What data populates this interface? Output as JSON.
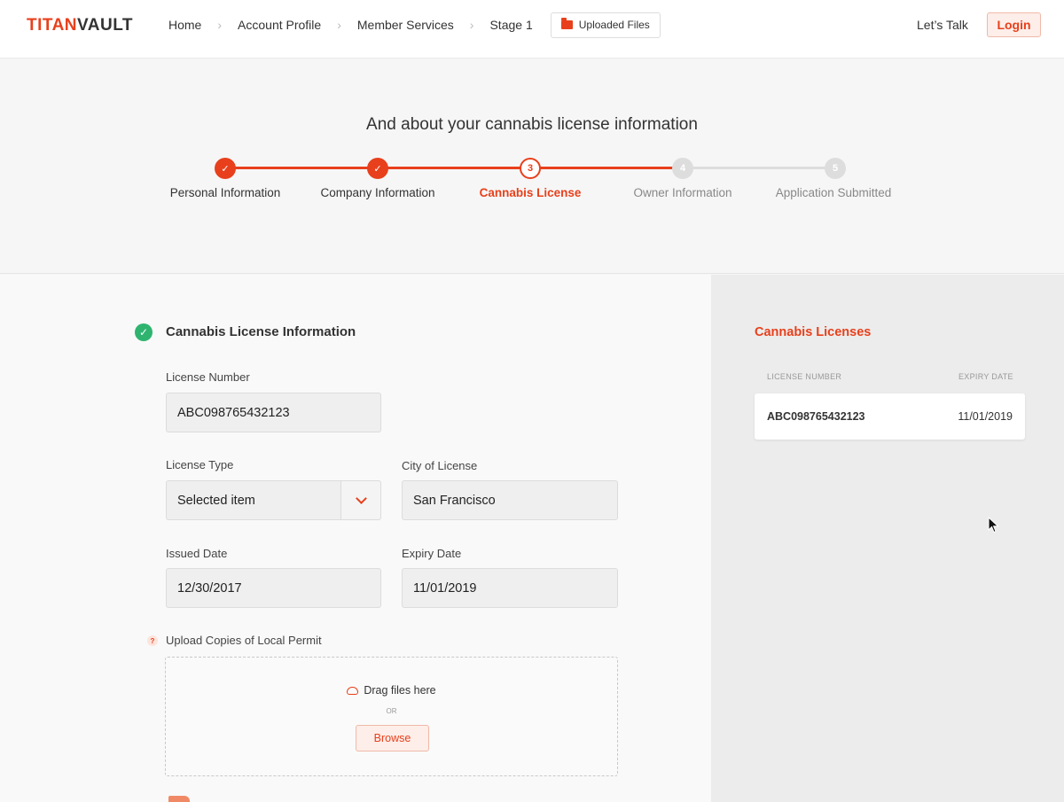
{
  "header": {
    "logo_prefix": "TITAN",
    "logo_suffix": "VAULT",
    "nav": [
      "Home",
      "Account Profile",
      "Member Services",
      "Stage 1"
    ],
    "uploaded_files": "Uploaded Files",
    "lets_talk": "Let’s Talk",
    "login": "Login",
    "accent_color": "#e8401c"
  },
  "hero": {
    "title": "And about your cannabis license information",
    "steps": [
      {
        "num": "1",
        "label": "Personal Information",
        "status": "done"
      },
      {
        "num": "2",
        "label": "Company Information",
        "status": "done"
      },
      {
        "num": "3",
        "label": "Cannabis License",
        "status": "current"
      },
      {
        "num": "4",
        "label": "Owner Information",
        "status": "todo"
      },
      {
        "num": "5",
        "label": "Application Submitted",
        "status": "todo"
      }
    ],
    "check_glyph": "✓"
  },
  "form": {
    "section_title": "Cannabis License Information",
    "license_number_label": "License Number",
    "license_number_value": "ABC098765432123",
    "license_type_label": "License Type",
    "license_type_value": "Selected item",
    "city_label": "City of License",
    "city_value": "San Francisco",
    "issued_label": "Issued Date",
    "issued_value": "12/30/2017",
    "expiry_label": "Expiry Date",
    "expiry_value": "11/01/2019",
    "upload_label": "Upload Copies of Local Permit",
    "help_glyph": "?",
    "drag_text": "Drag files here",
    "or_text": "OR",
    "browse": "Browse"
  },
  "side": {
    "title": "Cannabis Licenses",
    "col_license": "LICENSE NUMBER",
    "col_expiry": "EXPIRY DATE",
    "rows": [
      {
        "license": "ABC098765432123",
        "expiry": "11/01/2019"
      }
    ]
  }
}
